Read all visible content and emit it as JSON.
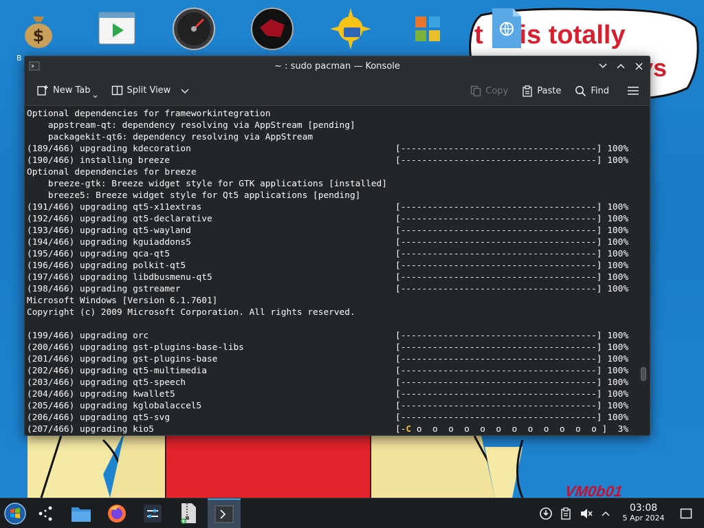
{
  "desktop": {
    "speech_text": "t is is totally",
    "speech_text_2": "ys",
    "watermark": "VM0b01",
    "icon_caption": "B",
    "icons": [
      "money-bag-icon",
      "media-player-icon",
      "speedometer-icon",
      "red-disc-icon",
      "sun-drive-icon",
      "apps-grid-icon",
      "document-globe-icon"
    ]
  },
  "window": {
    "title": "~ : sudo pacman — Konsole",
    "toolbar": {
      "new_tab": "New Tab",
      "split_view": "Split View",
      "copy": "Copy",
      "paste": "Paste",
      "find": "Find"
    }
  },
  "terminal": {
    "lines": [
      {
        "type": "text",
        "text": "Optional dependencies for frameworkintegration"
      },
      {
        "type": "text",
        "text": "    appstream-qt: dependency resolving via AppStream [pending]"
      },
      {
        "type": "text",
        "text": "    packagekit-qt6: dependency resolving via AppStream"
      },
      {
        "type": "progress",
        "text": "(189/466) upgrading kdecoration",
        "bar": "[-------------------------------------]",
        "pct": "100%"
      },
      {
        "type": "progress",
        "text": "(190/466) installing breeze",
        "bar": "[-------------------------------------]",
        "pct": "100%"
      },
      {
        "type": "text",
        "text": "Optional dependencies for breeze"
      },
      {
        "type": "text",
        "text": "    breeze-gtk: Breeze widget style for GTK applications [installed]"
      },
      {
        "type": "text",
        "text": "    breeze5: Breeze widget style for Qt5 applications [pending]"
      },
      {
        "type": "progress",
        "text": "(191/466) upgrading qt5-x11extras",
        "bar": "[-------------------------------------]",
        "pct": "100%"
      },
      {
        "type": "progress",
        "text": "(192/466) upgrading qt5-declarative",
        "bar": "[-------------------------------------]",
        "pct": "100%"
      },
      {
        "type": "progress",
        "text": "(193/466) upgrading qt5-wayland",
        "bar": "[-------------------------------------]",
        "pct": "100%"
      },
      {
        "type": "progress",
        "text": "(194/466) upgrading kguiaddons5",
        "bar": "[-------------------------------------]",
        "pct": "100%"
      },
      {
        "type": "progress",
        "text": "(195/466) upgrading qca-qt5",
        "bar": "[-------------------------------------]",
        "pct": "100%"
      },
      {
        "type": "progress",
        "text": "(196/466) upgrading polkit-qt5",
        "bar": "[-------------------------------------]",
        "pct": "100%"
      },
      {
        "type": "progress",
        "text": "(197/466) upgrading libdbusmenu-qt5",
        "bar": "[-------------------------------------]",
        "pct": "100%"
      },
      {
        "type": "progress",
        "text": "(198/466) upgrading gstreamer",
        "bar": "[-------------------------------------]",
        "pct": "100%"
      },
      {
        "type": "text",
        "text": "Microsoft Windows [Version 6.1.7601]"
      },
      {
        "type": "text",
        "text": "Copyright (c) 2009 Microsoft Corporation. All rights reserved."
      },
      {
        "type": "text",
        "text": ""
      },
      {
        "type": "progress",
        "text": "(199/466) upgrading orc",
        "bar": "[-------------------------------------]",
        "pct": "100%"
      },
      {
        "type": "progress",
        "text": "(200/466) upgrading gst-plugins-base-libs",
        "bar": "[-------------------------------------]",
        "pct": "100%"
      },
      {
        "type": "progress",
        "text": "(201/466) upgrading gst-plugins-base",
        "bar": "[-------------------------------------]",
        "pct": "100%"
      },
      {
        "type": "progress",
        "text": "(202/466) upgrading qt5-multimedia",
        "bar": "[-------------------------------------]",
        "pct": "100%"
      },
      {
        "type": "progress",
        "text": "(203/466) upgrading qt5-speech",
        "bar": "[-------------------------------------]",
        "pct": "100%"
      },
      {
        "type": "progress",
        "text": "(204/466) upgrading kwallet5",
        "bar": "[-------------------------------------]",
        "pct": "100%"
      },
      {
        "type": "progress",
        "text": "(205/466) upgrading kglobalaccel5",
        "bar": "[-------------------------------------]",
        "pct": "100%"
      },
      {
        "type": "progress",
        "text": "(206/466) upgrading qt5-svg",
        "bar": "[-------------------------------------]",
        "pct": "100%"
      },
      {
        "type": "progress_pacman",
        "text": "(207/466) upgrading kio5",
        "bar_start": "[-",
        "pac": "C",
        "bar_rest": " o  o  o  o  o  o  o  o  o  o  o  o ]",
        "pct": "  3%"
      }
    ]
  },
  "taskbar": {
    "clock_time": "03:08",
    "clock_date": "5 Apr 2024"
  },
  "colors": {
    "terminal_bg": "#232629",
    "terminal_fg": "#fcfcfc",
    "pacman": "#f6c344",
    "accent": "#3daee9"
  }
}
